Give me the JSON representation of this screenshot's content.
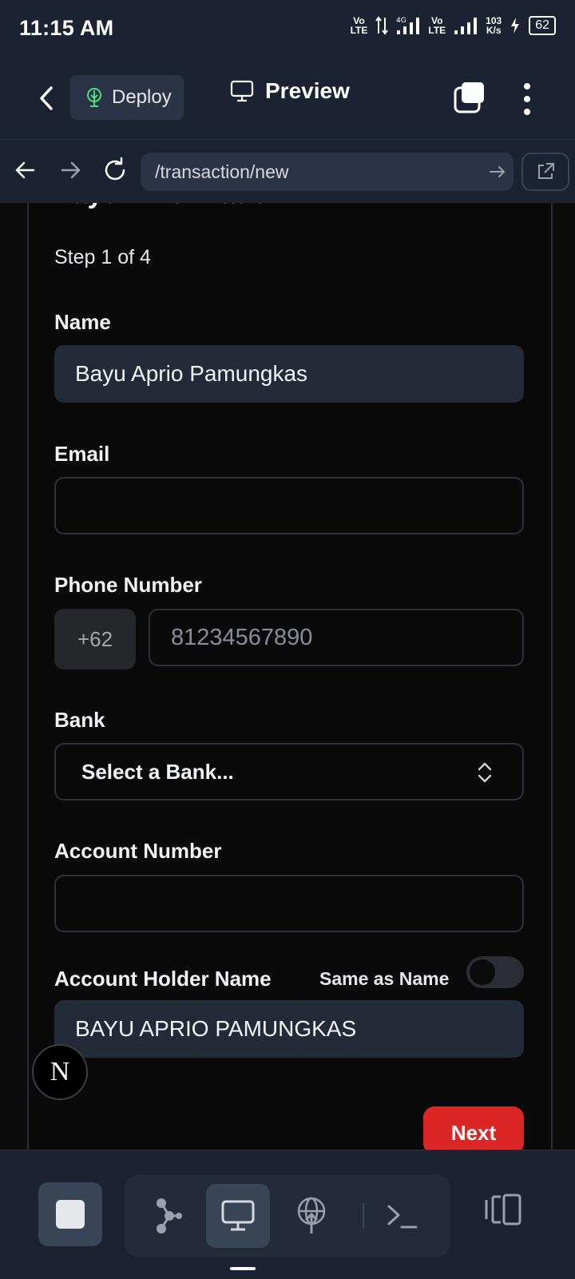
{
  "status_bar": {
    "time": "11:15 AM",
    "net1": "Vo\nLTE",
    "net_type": "4G",
    "net2": "Vo\nLTE",
    "speed": "103\nK/s",
    "battery": "62"
  },
  "header": {
    "deploy_label": "Deploy",
    "preview_label": "Preview"
  },
  "url_bar": {
    "path": "/transaction/new"
  },
  "form": {
    "title": "Payer Information",
    "step": "Step 1 of 4",
    "name_label": "Name",
    "name_value": "Bayu Aprio Pamungkas",
    "email_label": "Email",
    "email_value": "",
    "phone_label": "Phone Number",
    "phone_prefix": "+62",
    "phone_placeholder": "81234567890",
    "bank_label": "Bank",
    "bank_value": "Select a Bank...",
    "account_number_label": "Account Number",
    "account_number_value": "",
    "holder_label": "Account Holder Name",
    "same_as_name_label": "Same as Name",
    "same_as_name_on": false,
    "holder_value": "BAYU APRIO PAMUNGKAS",
    "next_label": "Next"
  },
  "next_badge": "N",
  "colors": {
    "chrome": "#1b2333",
    "accent_red": "#dc2626",
    "field_fill": "#232a38"
  },
  "icons": [
    "back-icon",
    "deploy-icon",
    "monitor-icon",
    "copy-icon",
    "more-vert-icon",
    "arrow-left-icon",
    "arrow-right-icon",
    "refresh-icon",
    "open-external-icon",
    "stop-icon",
    "graph-icon",
    "monitor-icon",
    "globe-upload-icon",
    "terminal-icon",
    "layout-icon"
  ]
}
